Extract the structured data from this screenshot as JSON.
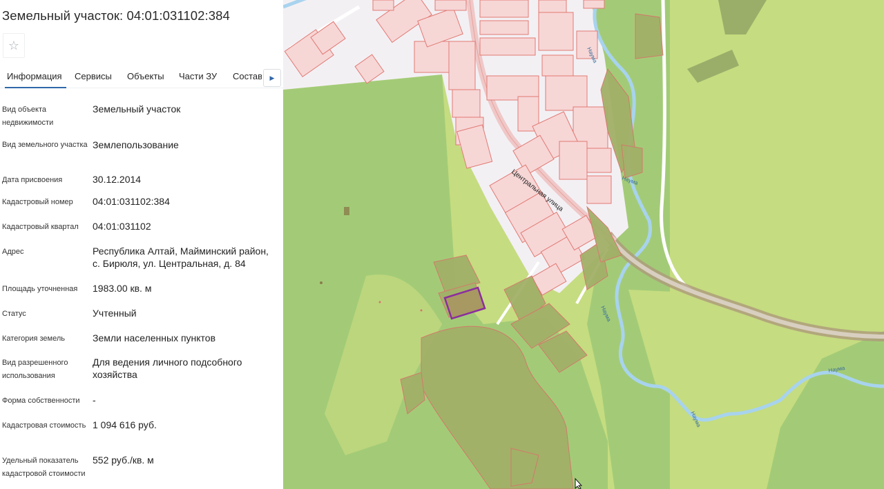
{
  "panel": {
    "title": "Земельный участок: 04:01:031102:384",
    "favorite_icon": "star-outline-icon",
    "tabs": [
      "Информация",
      "Сервисы",
      "Объекты",
      "Части ЗУ",
      "Состав"
    ],
    "active_tab": "Информация",
    "tab_scroll_icon": "triangle-right-icon",
    "fields": [
      {
        "label": "Вид объекта недвижимости",
        "value": "Земельный участок"
      },
      {
        "label": "Вид земельного участка",
        "value": "Землепользование"
      },
      {
        "label": "Дата присвоения",
        "value": "30.12.2014"
      },
      {
        "label": "Кадастровый номер",
        "value": "04:01:031102:384"
      },
      {
        "label": "Кадастровый квартал",
        "value": "04:01:031102"
      },
      {
        "label": "Адрес",
        "value": "Республика Алтай, Майминский район, с. Бирюля, ул. Центральная, д. 84"
      },
      {
        "label": "Площадь уточненная",
        "value": "1983.00 кв. м"
      },
      {
        "label": "Статус",
        "value": "Учтенный"
      },
      {
        "label": "Категория земель",
        "value": "Земли населенных пунктов"
      },
      {
        "label": "Вид разрешенного использования",
        "value": "Для ведения личного подсобного хозяйства"
      },
      {
        "label": "Форма собственности",
        "value": "-"
      },
      {
        "label": "Кадастровая стоимость",
        "value": "1 094 616 руб."
      },
      {
        "label": "Удельный показатель кадастровой стоимости",
        "value": "552 руб./кв. м"
      }
    ]
  },
  "map": {
    "street_label": "Центральная улица",
    "river_label": "Наума",
    "cursor_icon": "mouse-pointer-icon",
    "colors": {
      "forest_light": "#c5dc80",
      "forest_dark": "#a3cb77",
      "settlement": "#f3f0f4",
      "parcel_fill": "#f7d6d6",
      "parcel_stroke": "#e07a72",
      "river": "#a8d3ee",
      "selected_parcel": "#8b2d9e"
    }
  }
}
